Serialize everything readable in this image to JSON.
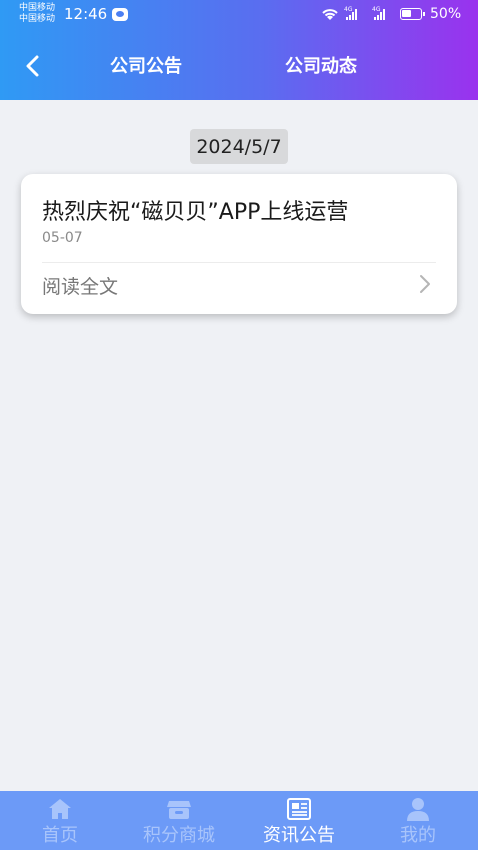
{
  "status_bar": {
    "carrier_1": "中国移动",
    "carrier_2": "中国移动",
    "time": "12:46",
    "network_1": "4G",
    "network_2": "4G",
    "battery": "50%"
  },
  "header": {
    "tabs": [
      {
        "label": "公司公告",
        "active": true
      },
      {
        "label": "公司动态",
        "active": false
      }
    ],
    "gradient_start": "#2f9af4",
    "gradient_end": "#9a32ee"
  },
  "feed": {
    "date_label": "2024/5/7",
    "items": [
      {
        "title": "热烈庆祝“磁贝贝”APP上线运营",
        "date": "05-07",
        "read_more": "阅读全文"
      }
    ]
  },
  "bottom_nav": {
    "background": "#6c9af7",
    "items": [
      {
        "label": "首页",
        "icon": "home-icon",
        "active": false
      },
      {
        "label": "积分商城",
        "icon": "shop-icon",
        "active": false
      },
      {
        "label": "资讯公告",
        "icon": "news-icon",
        "active": true
      },
      {
        "label": "我的",
        "icon": "user-icon",
        "active": false
      }
    ]
  }
}
